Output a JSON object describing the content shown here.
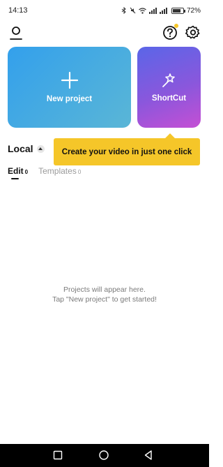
{
  "status_bar": {
    "time": "14:13",
    "battery_percent": "72%",
    "icons": [
      "bluetooth-icon",
      "mute-icon",
      "wifi-icon",
      "signal-icon",
      "signal-icon",
      "battery-icon"
    ],
    "battery_level": 0.72
  },
  "header": {
    "icons": [
      "profile-icon",
      "help-icon",
      "settings-icon"
    ],
    "help_badge_color": "#f5c629"
  },
  "cards": {
    "new_project": {
      "label": "New project",
      "icon": "plus-icon"
    },
    "shortcut": {
      "label": "ShortCut",
      "icon": "magic-wand-icon"
    }
  },
  "local": {
    "title": "Local",
    "caret_icon": "caret-up-icon"
  },
  "tooltip": {
    "text": "Create your video in just one click",
    "color": "#f5c629"
  },
  "tabs": [
    {
      "label": "Edit",
      "count": "0",
      "active": true
    },
    {
      "label": "Templates",
      "count": "0",
      "active": false
    }
  ],
  "empty_state": {
    "line1": "Projects will appear here.",
    "line2": "Tap \"New project\" to get started!"
  },
  "nav_bar": {
    "buttons": [
      "recents-square-icon",
      "home-circle-icon",
      "back-triangle-icon"
    ]
  },
  "colors": {
    "accent_yellow": "#f5c629",
    "new_project_gradient": [
      "#33a0ec",
      "#5ab6d6"
    ],
    "shortcut_gradient": [
      "#5a66e8",
      "#8a57dc",
      "#c54fd4"
    ]
  }
}
